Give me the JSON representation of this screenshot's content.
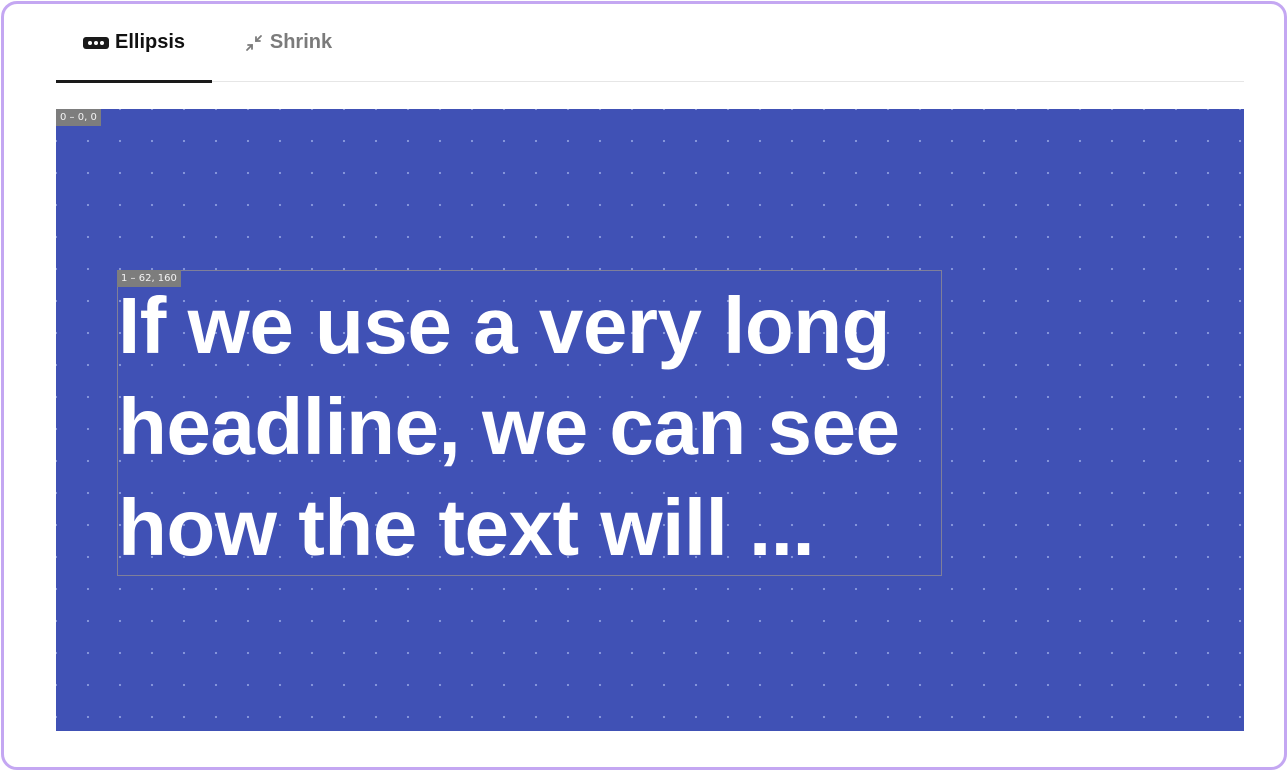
{
  "tabs": [
    {
      "label": "Ellipsis",
      "icon": "ellipsis-icon",
      "active": true
    },
    {
      "label": "Shrink",
      "icon": "shrink-icon",
      "active": false
    }
  ],
  "canvas": {
    "background_color": "#4051b5",
    "frame_label": "0 – 0, 0",
    "text_frame": {
      "label": "1 – 62, 160",
      "headline": "If we use a very long\nheadline, we can see\nhow the text will ..."
    }
  },
  "colors": {
    "border_accent": "#c4a7f2",
    "active_tab_text": "#111111",
    "inactive_tab_text": "#7b7b7b",
    "headline_text": "#ffffff"
  }
}
